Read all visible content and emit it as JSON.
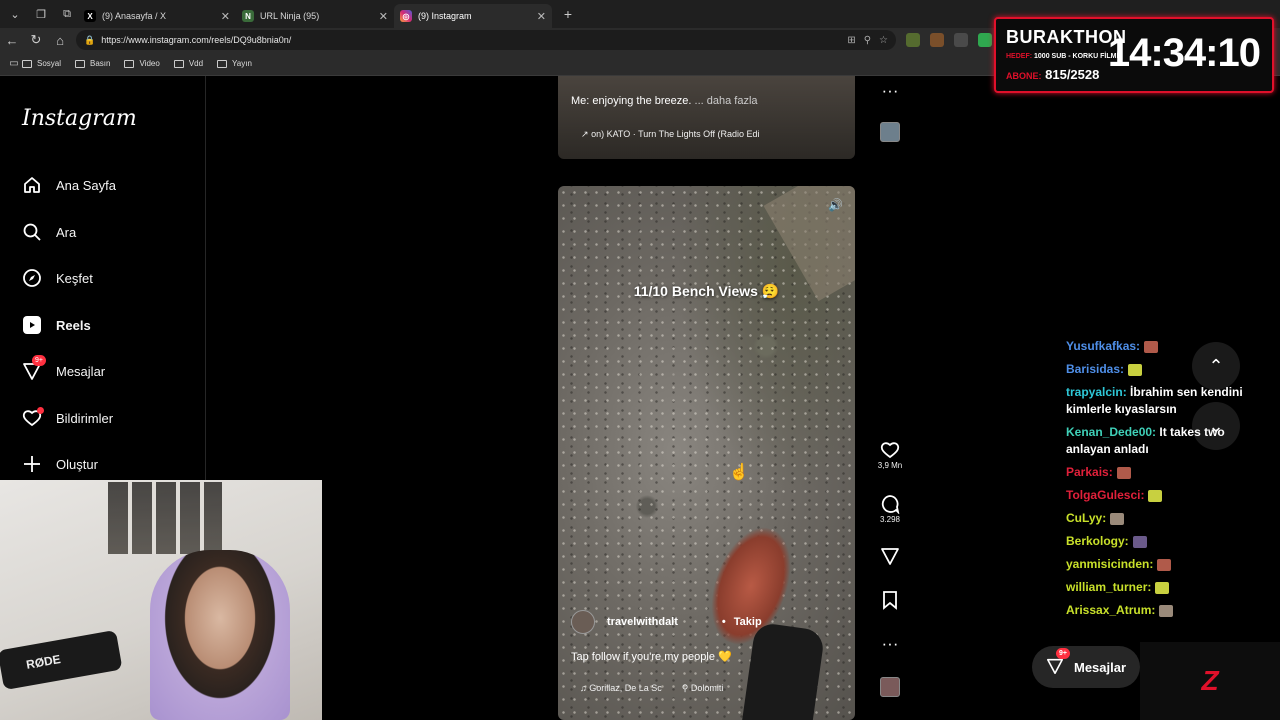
{
  "browser": {
    "tabs": [
      {
        "label": "(9) Anasayfa / X",
        "icon": "x-logo-icon",
        "active": false
      },
      {
        "label": "URL Ninja (95)",
        "icon": "ninja-icon",
        "active": false
      },
      {
        "label": "(9) Instagram",
        "icon": "instagram-icon",
        "active": true
      }
    ],
    "url": "https://www.instagram.com/reels/DQ9u8bnia0n/",
    "bookmarks": [
      "Sosyal",
      "Basın",
      "Video",
      "Vdd",
      "Yayın"
    ]
  },
  "instagram": {
    "logo": "Instagram",
    "nav": [
      {
        "label": "Ana Sayfa",
        "icon": "home-icon"
      },
      {
        "label": "Ara",
        "icon": "search-icon"
      },
      {
        "label": "Keşfet",
        "icon": "compass-icon"
      },
      {
        "label": "Reels",
        "icon": "reels-icon"
      },
      {
        "label": "Mesajlar",
        "icon": "messenger-icon",
        "badge": "9+"
      },
      {
        "label": "Bildirimler",
        "icon": "heart-icon"
      },
      {
        "label": "Oluştur",
        "icon": "plus-icon"
      }
    ],
    "prev_reel": {
      "caption": "Me: enjoying the breeze.",
      "more": "... daha fazla",
      "music": "on)  KATO · Turn The Lights Off (Radio Edi"
    },
    "reel": {
      "overlay_text": "11/10 Bench Views 😮‍💨",
      "username": "travelwithdalt",
      "follow": "Takip",
      "caption": "Tap follow if you're my people 💛",
      "music": "Gorillaz, De La Sc",
      "location": "Dolomiti"
    },
    "actions": {
      "likes": "3,9 Mn",
      "comments": "3.298"
    },
    "messages_button": {
      "label": "Mesajlar",
      "badge": "9+"
    }
  },
  "stream": {
    "timer": {
      "name": "BURAKTHON",
      "goal_prefix": "HEDEF:",
      "goal": "1000 SUB - KORKU FİLMİ",
      "sub_prefix": "ABONE:",
      "sub_count": "815/2528",
      "clock": "14:34:10"
    },
    "chat": [
      {
        "user": "Yusufkafkas:",
        "text": "",
        "color": "#4f8fe8"
      },
      {
        "user": "Barisidas:",
        "text": "",
        "color": "#4f8fe8"
      },
      {
        "user": "trapyalcin:",
        "text": "İbrahim sen kendini kimlerle kıyaslarsın",
        "color": "#2ec8d8"
      },
      {
        "user": "Kenan_Dede00:",
        "text": "It takes two anlayan anladı",
        "color": "#3fd0b8"
      },
      {
        "user": "Parkais:",
        "text": "",
        "color": "#e0203a"
      },
      {
        "user": "TolgaGulesci:",
        "text": "",
        "color": "#e0203a"
      },
      {
        "user": "CuLyy:",
        "text": "",
        "color": "#c8e02a"
      },
      {
        "user": "Berkology:",
        "text": "",
        "color": "#c8e02a"
      },
      {
        "user": "yanmisicinden:",
        "text": "",
        "color": "#c8e02a"
      },
      {
        "user": "william_turner:",
        "text": "",
        "color": "#c8e02a"
      },
      {
        "user": "Arissax_Atrum:",
        "text": "",
        "color": "#c8e02a"
      }
    ],
    "webcam_text": "RØDE"
  }
}
